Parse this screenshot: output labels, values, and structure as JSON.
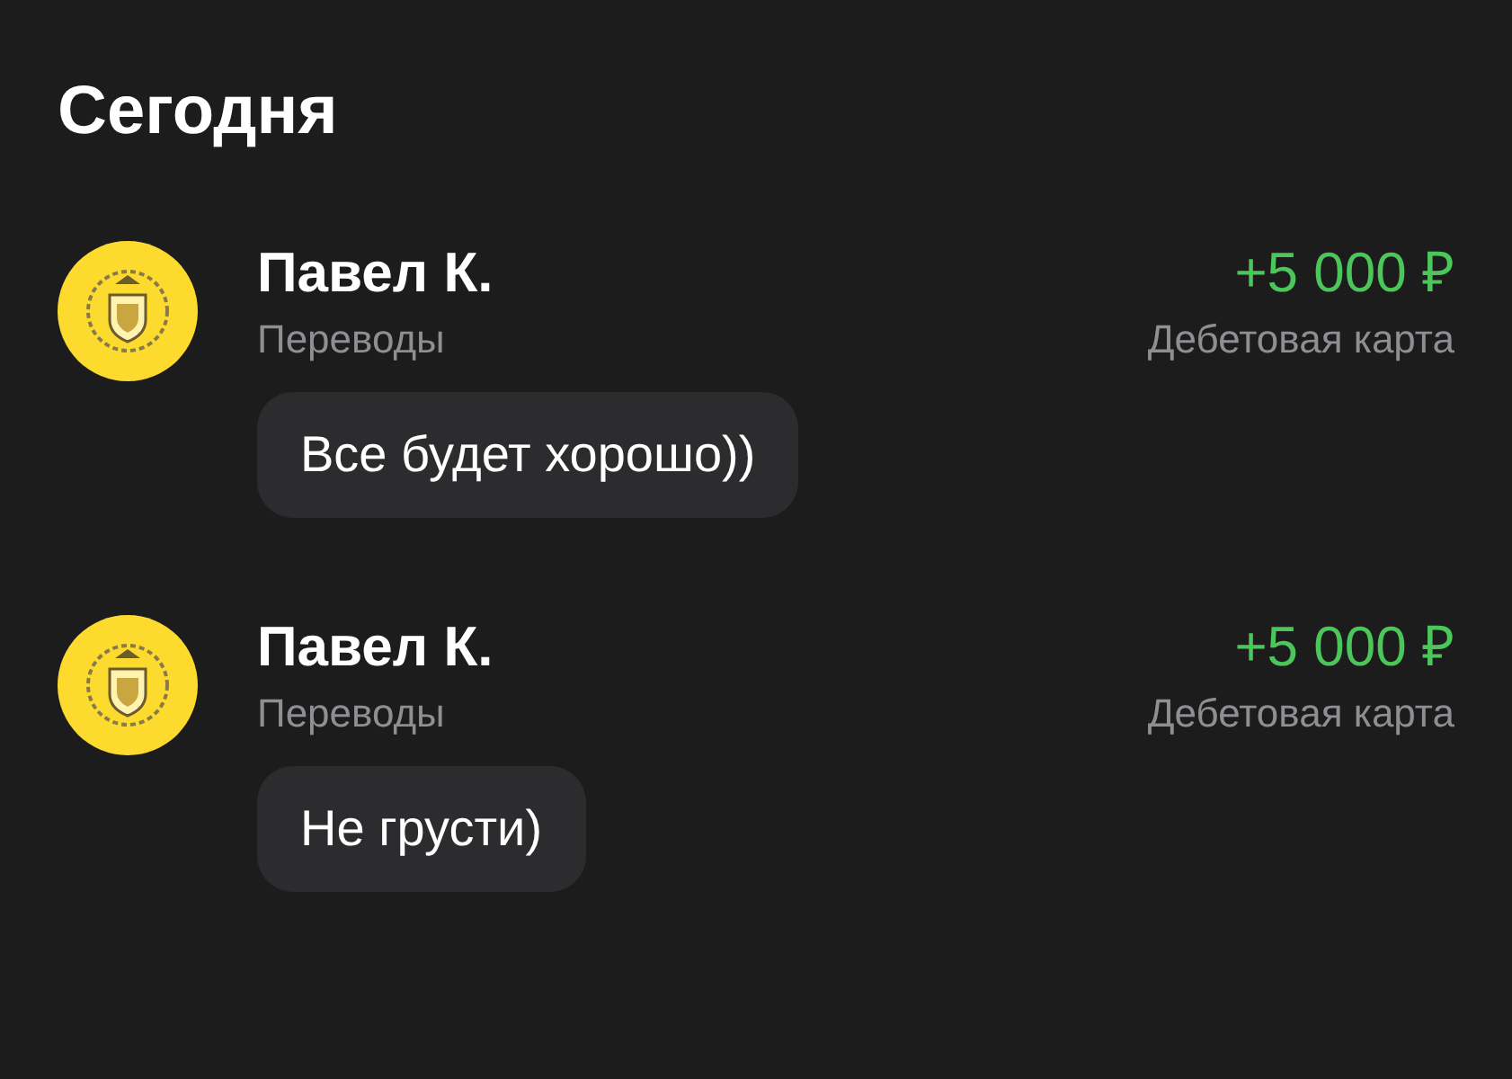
{
  "title": "Сегодня",
  "operations": [
    {
      "name": "Павел К.",
      "category": "Переводы",
      "amount": "+5 000 ₽",
      "account": "Дебетовая карта",
      "message": "Все будет хорошо))"
    },
    {
      "name": "Павел К.",
      "category": "Переводы",
      "amount": "+5 000 ₽",
      "account": "Дебетовая карта",
      "message": "Не грусти)"
    }
  ]
}
